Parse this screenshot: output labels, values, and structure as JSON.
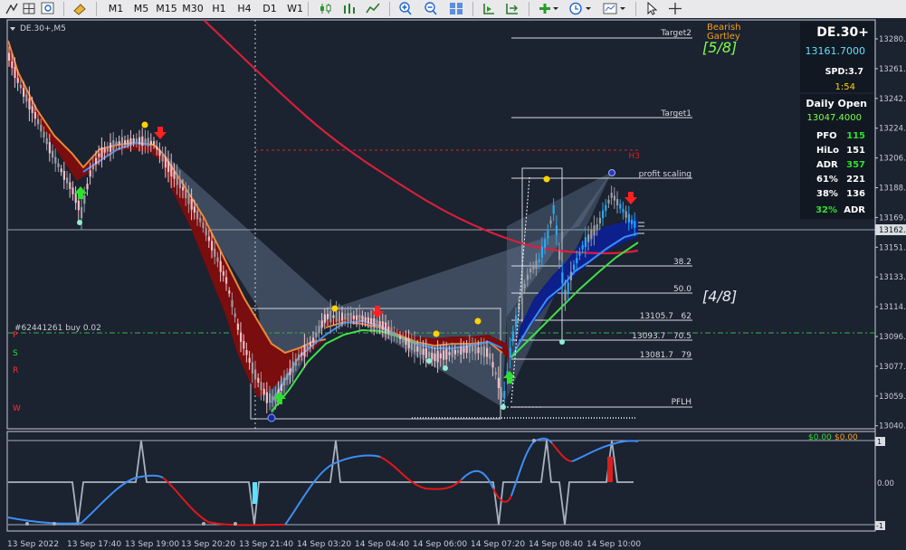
{
  "toolbar": {
    "timeframes": [
      "M1",
      "M5",
      "M15",
      "M30",
      "H1",
      "H4",
      "D1",
      "W1"
    ]
  },
  "chart": {
    "symbol_label": "DE.30+,M5",
    "order_label": "#62441261 buy 0.02",
    "psrw": [
      "P",
      "S",
      "R",
      "W"
    ],
    "pattern_name_line1": "Bearish",
    "pattern_name_line2": "Gartley",
    "pattern_count_top": "[5/8]",
    "pattern_count_mid": "[4/8]",
    "level_labels": {
      "target2": "Target2",
      "target1": "Target1",
      "h3": "H3",
      "profit_scaling": "profit scaling",
      "fib_382": "38.2",
      "fib_500": "50.0",
      "fib_62": "13105.7   62",
      "fib_705": "13093.7   70.5",
      "fib_79": "13081.7   79",
      "pflh": "PFLH"
    },
    "price_axis": [
      "13280.",
      "13261.",
      "13242.",
      "13224.",
      "13206.",
      "13188.",
      "13169.",
      "13151.",
      "13133.",
      "13114.",
      "13096.",
      "13077.",
      "13059.",
      "13040."
    ],
    "current_price": "13162.",
    "oscillator_axis": [
      "1",
      "0.00",
      "-1"
    ],
    "oscillator_values": [
      "$0.00",
      "$0.00"
    ],
    "time_axis": [
      "13 Sep 2022",
      "13 Sep 17:40",
      "13 Sep 19:00",
      "13 Sep 20:20",
      "13 Sep 21:40",
      "14 Sep 03:20",
      "14 Sep 04:40",
      "14 Sep 06:00",
      "14 Sep 07:20",
      "14 Sep 08:40",
      "14 Sep 10:00"
    ]
  },
  "info_panel": {
    "symbol": "DE.30+",
    "price": "13161.7000",
    "spread": "SPD:3.7",
    "timer": "1:54",
    "daily_open_label": "Daily Open",
    "daily_open_value": "13047.4000",
    "rows": [
      {
        "label": "PFO",
        "value": "115"
      },
      {
        "label": "HiLo",
        "value": "151"
      },
      {
        "label": "ADR",
        "value": "357"
      },
      {
        "label": "61%",
        "value": "221"
      },
      {
        "label": "38%",
        "value": "136"
      }
    ],
    "adr_pct_value": "32%",
    "adr_pct_label": "ADR"
  },
  "colors": {
    "background": "#1b2230",
    "pattern_fill": "#5b6d86",
    "ribbon_dark": "#7a0d0d",
    "ribbon_edge": "#e8893a",
    "ma_red": "#d81f3a",
    "line_blue": "#3d8ef5",
    "line_green": "#3ee04a",
    "accent_yellow": "#ffd400",
    "accent_green_text": "#7dff4a",
    "cyan_text": "#5fe0ff"
  }
}
